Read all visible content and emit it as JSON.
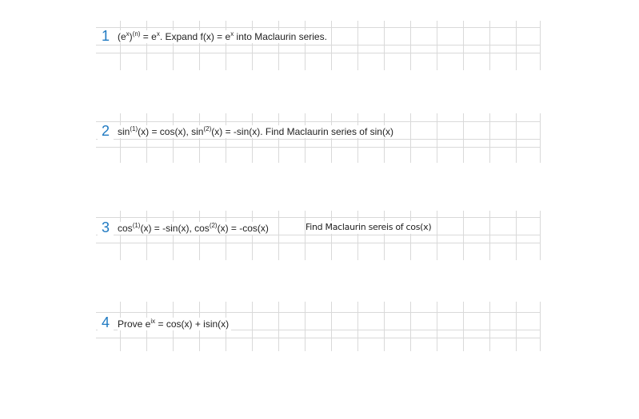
{
  "problems": [
    {
      "number": "1",
      "parts": [
        "(e",
        "x",
        ")",
        "(n)",
        " = e",
        "x",
        ". Expand f(x) = e",
        "x",
        " into  Maclaurin series."
      ]
    },
    {
      "number": "2",
      "parts": [
        "sin",
        "(1)",
        "(x) = cos(x), sin",
        "(2)",
        "(x) = -sin(x). Find Maclaurin series of sin(x)"
      ]
    },
    {
      "number": "3",
      "parts": [
        "cos",
        "(1)",
        "(x) = -sin(x), cos",
        "(2)",
        "(x) = -cos(x)"
      ],
      "extra": "Find Maclaurin sereis of cos(x)"
    },
    {
      "number": "4",
      "parts": [
        "Prove e",
        "ix",
        " = cos(x) + isin(x)"
      ]
    }
  ]
}
